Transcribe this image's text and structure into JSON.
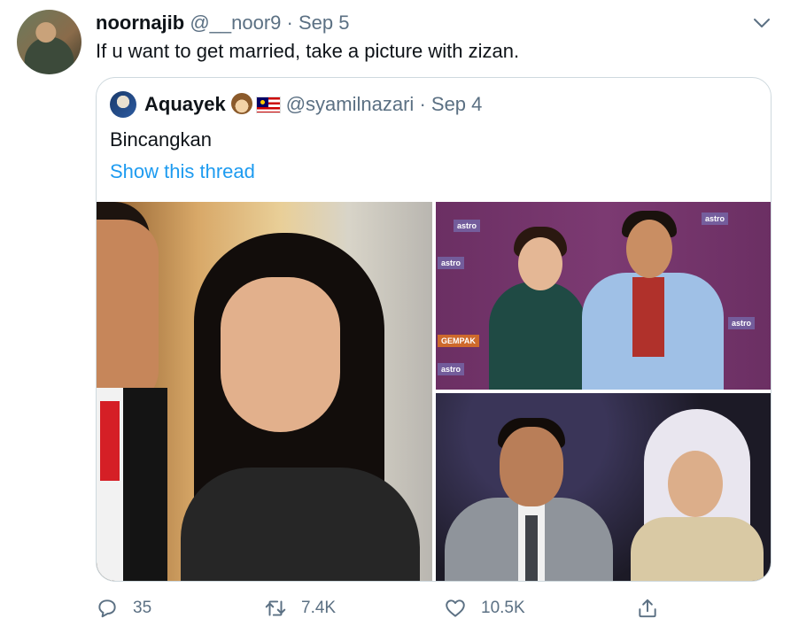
{
  "tweet": {
    "name": "noornajib",
    "handle": "@__noor9",
    "separator": "·",
    "date": "Sep 5",
    "text": "If u want to get married, take a picture with zizan."
  },
  "quote": {
    "name": "Aquayek",
    "handle": "@syamilnazari",
    "separator": "·",
    "date": "Sep 4",
    "text": "Bincangkan",
    "thread_link": "Show this thread",
    "images": [
      {
        "label": "photo-couple-sequin-dress"
      },
      {
        "label": "photo-couple-red-carpet",
        "logos": [
          "astro",
          "astro",
          "astro",
          "astro",
          "GEMPAK",
          "astro"
        ]
      },
      {
        "label": "photo-couple-hijab"
      }
    ]
  },
  "actions": {
    "reply_count": "35",
    "retweet_count": "7.4K",
    "like_count": "10.5K"
  },
  "icons": {
    "caret": "chevron-down-icon",
    "reply": "reply-icon",
    "retweet": "retweet-icon",
    "like": "heart-icon",
    "share": "share-icon"
  },
  "colors": {
    "link": "#1d9bf0",
    "muted": "#5b7083",
    "border": "#cfd9de"
  }
}
